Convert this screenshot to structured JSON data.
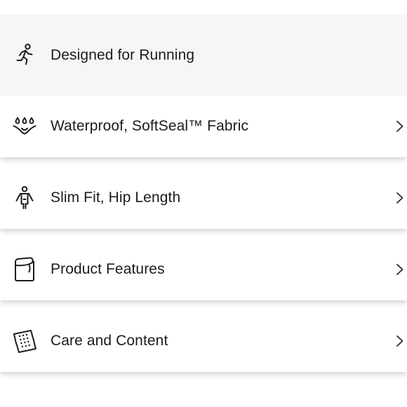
{
  "header": {
    "label": "Designed for Running",
    "icon": "runner-icon"
  },
  "rows": [
    {
      "label": "Waterproof, SoftSeal™ Fabric",
      "icon": "water-drops-icon"
    },
    {
      "label": "Slim Fit, Hip Length",
      "icon": "person-fit-icon"
    },
    {
      "label": "Product Features",
      "icon": "pocket-icon"
    },
    {
      "label": "Care and Content",
      "icon": "fabric-tag-icon"
    }
  ],
  "colors": {
    "text": "#1c1c1c",
    "header_background": "#f6f6f6",
    "row_background": "#ffffff"
  }
}
